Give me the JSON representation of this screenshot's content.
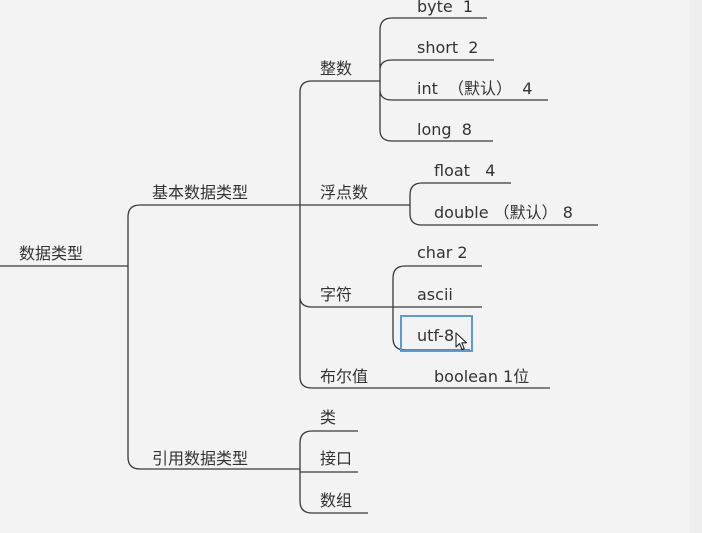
{
  "mindmap": {
    "root": "数据类型",
    "primitive": {
      "label": "基本数据类型",
      "integer": {
        "label": "整数",
        "items": [
          "byte  1",
          "short  2",
          "int  （默认）  4",
          "long  8"
        ]
      },
      "float": {
        "label": "浮点数",
        "items": [
          "float   4",
          "double （默认） 8"
        ]
      },
      "char": {
        "label": "字符",
        "items": [
          "char 2",
          "ascii",
          "utf-8"
        ]
      },
      "bool": {
        "label": "布尔值",
        "items": [
          "boolean 1位"
        ]
      }
    },
    "reference": {
      "label": "引用数据类型",
      "items": [
        "类",
        "接口",
        "数组"
      ]
    }
  },
  "colors": {
    "line": "#3a3a3a",
    "selection": "#5b9bd5",
    "background": "#f3f3f3"
  }
}
